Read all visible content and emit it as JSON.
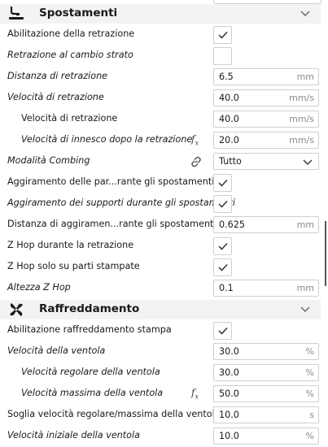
{
  "categories": {
    "travel": {
      "title": "Spostamenti",
      "icon": "travel-icon"
    },
    "cooling": {
      "title": "Raffreddamento",
      "icon": "fan-icon"
    }
  },
  "rows": [
    {
      "label": "Abilitazione della retrazione",
      "italic": false,
      "type": "checkbox",
      "checked": true
    },
    {
      "label": "Retrazione al cambio strato",
      "italic": true,
      "type": "checkbox",
      "checked": false
    },
    {
      "label": "Distanza di retrazione",
      "italic": true,
      "type": "field",
      "value": "6.5",
      "unit": "mm"
    },
    {
      "label": "Velocità di retrazione",
      "italic": true,
      "type": "field",
      "value": "40.0",
      "unit": "mm/s"
    },
    {
      "label": "Velocità di retrazione",
      "italic": false,
      "type": "field",
      "value": "40.0",
      "unit": "mm/s"
    },
    {
      "label": "Velocità di innesco dopo la retrazione",
      "italic": true,
      "type": "field",
      "value": "20.0",
      "unit": "mm/s",
      "fx": "f",
      "fx_sub": "x"
    },
    {
      "label": "Modalità Combing",
      "italic": true,
      "type": "dropdown",
      "value": "Tutto"
    },
    {
      "label": "Aggiramento delle par...rante gli spostamenti",
      "italic": false,
      "type": "checkbox",
      "checked": true
    },
    {
      "label": "Aggiramento dei supporti durante gli spostamenti",
      "italic": true,
      "type": "checkbox",
      "checked": true
    },
    {
      "label": "Distanza di aggiramen...rante gli spostamenti",
      "italic": false,
      "type": "field",
      "value": "0.625",
      "unit": "mm"
    },
    {
      "label": "Z Hop durante la retrazione",
      "italic": false,
      "type": "checkbox",
      "checked": true
    },
    {
      "label": "Z Hop solo su parti stampate",
      "italic": false,
      "type": "checkbox",
      "checked": true
    },
    {
      "label": "Altezza Z Hop",
      "italic": true,
      "type": "field",
      "value": "0.1",
      "unit": "mm"
    },
    {
      "label": "Abilitazione raffreddamento stampa",
      "italic": false,
      "type": "checkbox",
      "checked": true
    },
    {
      "label": "Velocità della ventola",
      "italic": true,
      "type": "field",
      "value": "30.0",
      "unit": "%"
    },
    {
      "label": "Velocità regolare della ventola",
      "italic": true,
      "type": "field",
      "value": "30.0",
      "unit": "%"
    },
    {
      "label": "Velocità massima della ventola",
      "italic": true,
      "type": "field",
      "value": "50.0",
      "unit": "%",
      "fx": "f",
      "fx_sub": "x"
    },
    {
      "label": "Soglia velocità regolare/massima della ventola",
      "italic": false,
      "type": "field",
      "value": "10.0",
      "unit": "s"
    },
    {
      "label": "Velocità iniziale della ventola",
      "italic": true,
      "type": "field",
      "value": "10.0",
      "unit": "%"
    }
  ]
}
